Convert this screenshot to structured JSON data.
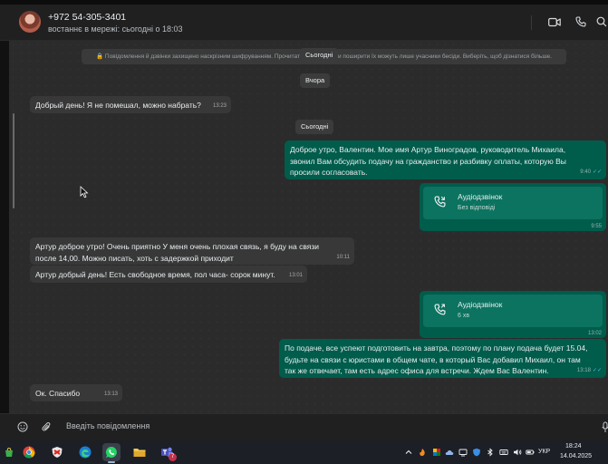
{
  "header": {
    "contact_name": "+972 54-305-3401",
    "contact_status": "востаннє в мережі: сьогодні о 18:03"
  },
  "chat": {
    "encryption_notice": "🔒 Повідомлення й дзвінки захищено наскрізним шифруванням. Прочитати, надіслати чи поширити їх можуть лише учасники бесіди. Виберіть, щоб дізнатися більше.",
    "dates": {
      "today_top": "Сьогодні",
      "yesterday": "Вчора",
      "today": "Сьогодні"
    },
    "messages": [
      {
        "text": "Добрый день! Я не помешал, можно набрать?",
        "time": "13:23"
      },
      {
        "text": "Доброе утро, Валентин. Мое имя Артур Виноградов, руководитель Михаила, звонил Вам обсудить подачу на гражданство и разбивку оплаты, которую Вы просили согласовать.",
        "time": "9:40"
      },
      {
        "call_title": "Аудіодзвінок",
        "call_sub": "Без відповіді",
        "time": "9:55"
      },
      {
        "text": "Артур доброе утро! Очень приятно У меня очень плохая связь, я буду на связи после 14,00. Можно писать, хоть с задержкой приходит",
        "time": "10:11"
      },
      {
        "text": "Артур добрый день! Есть свободное время, пол часа- сорок минут.",
        "time": "13:01"
      },
      {
        "call_title": "Аудіодзвінок",
        "call_sub": "6 хв",
        "time": "13:02"
      },
      {
        "text": "По подаче, все успеют подготовить на завтра, поэтому по плану подача будет 15.04, будьте на связи с юристами в общем чате, в который Вас добавил Михаил, он там так же отвечает, там есть адрес офиса для встречи. Ждем Вас Валентин.",
        "time": "13:18"
      },
      {
        "text": "Ок.  Спасибо",
        "time": "13:13"
      }
    ]
  },
  "composer": {
    "placeholder": "Введіть повідомлення"
  },
  "taskbar": {
    "language": "УКР",
    "time": "18:24",
    "date": "14.04.2025",
    "teams_badge": "7"
  },
  "colors": {
    "outgoing_bubble": "#005c4b",
    "incoming_bubble": "#383838",
    "read_ticks": "#53bdeb",
    "whatsapp_green": "#25d366"
  }
}
